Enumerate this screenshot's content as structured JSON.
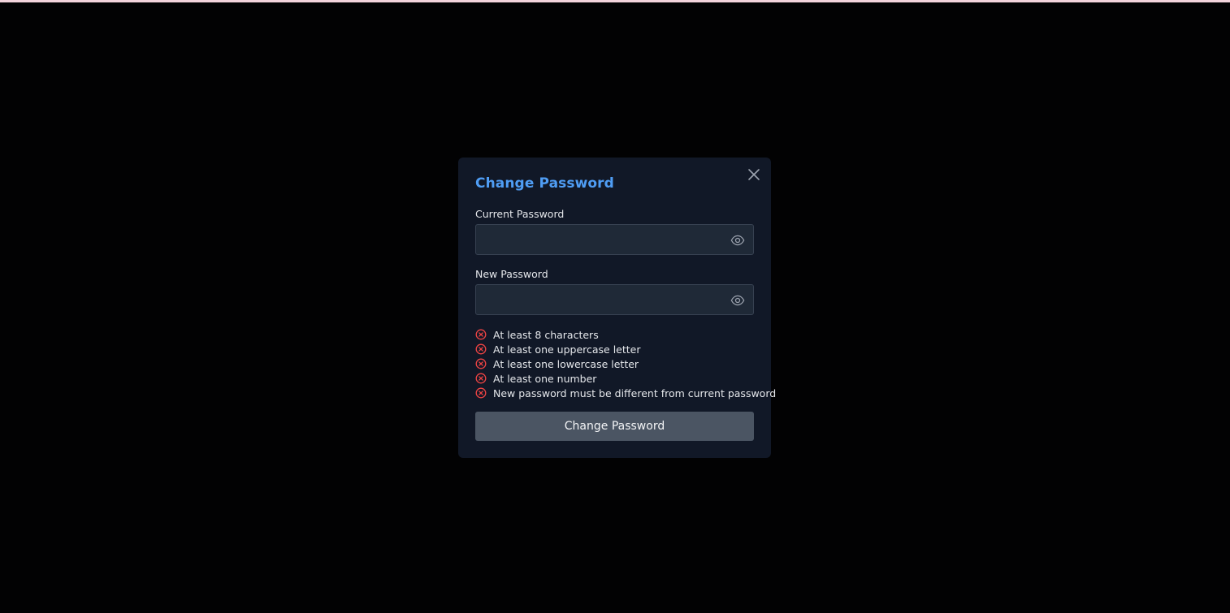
{
  "modal": {
    "title": "Change Password",
    "close_icon": "close-icon",
    "current_password": {
      "label": "Current Password",
      "value": "",
      "placeholder": "",
      "toggle_icon": "eye-icon"
    },
    "new_password": {
      "label": "New Password",
      "value": "",
      "placeholder": "",
      "toggle_icon": "eye-icon"
    },
    "requirements": [
      {
        "text": "At least 8 characters",
        "status": "unmet",
        "icon": "x-circle-icon"
      },
      {
        "text": "At least one uppercase letter",
        "status": "unmet",
        "icon": "x-circle-icon"
      },
      {
        "text": "At least one lowercase letter",
        "status": "unmet",
        "icon": "x-circle-icon"
      },
      {
        "text": "At least one number",
        "status": "unmet",
        "icon": "x-circle-icon"
      },
      {
        "text": "New password must be different from current password",
        "status": "unmet",
        "icon": "x-circle-icon"
      }
    ],
    "submit_label": "Change Password"
  },
  "colors": {
    "background": "#020203",
    "modal_bg": "#111827",
    "title": "#4f9df4",
    "input_bg": "#1f2937",
    "error": "#ef4444",
    "button_bg": "#4b5563",
    "top_strip": "#f2d4dc"
  }
}
